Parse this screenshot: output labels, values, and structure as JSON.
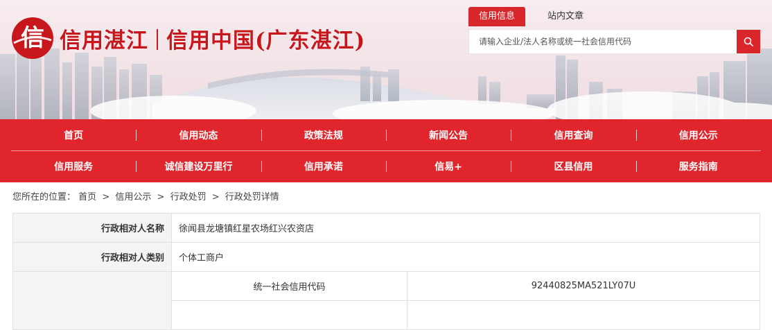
{
  "brand": {
    "seal_char": "信",
    "name": "信用湛江",
    "sub": "信用中国(广东湛江)"
  },
  "search": {
    "tabs": [
      {
        "label": "信用信息",
        "active": true
      },
      {
        "label": "站内文章",
        "active": false
      }
    ],
    "placeholder": "请输入企业/法人名称或统一社会信用代码",
    "button_icon": "search-icon"
  },
  "nav": {
    "row1": [
      "首页",
      "信用动态",
      "政策法规",
      "新闻公告",
      "信用查询",
      "信用公示"
    ],
    "row2": [
      "信用服务",
      "诚信建设万里行",
      "信用承诺",
      "信易+",
      "区县信用",
      "服务指南"
    ]
  },
  "breadcrumb": {
    "prefix": "您所在的位置：",
    "items": [
      "首页",
      "信用公示",
      "行政处罚",
      "行政处罚详情"
    ],
    "separator": ">"
  },
  "detail": {
    "rows": [
      {
        "label": "行政相对人名称",
        "value": "徐闻县龙塘镇红星农场红兴农资店"
      },
      {
        "label": "行政相对人类别",
        "value": "个体工商户"
      }
    ],
    "code_label": "统一社会信用代码",
    "code_value": "92440825MA521LY07U"
  },
  "colors": {
    "brand_red": "#e0262c",
    "accent_red": "#d9262b"
  }
}
